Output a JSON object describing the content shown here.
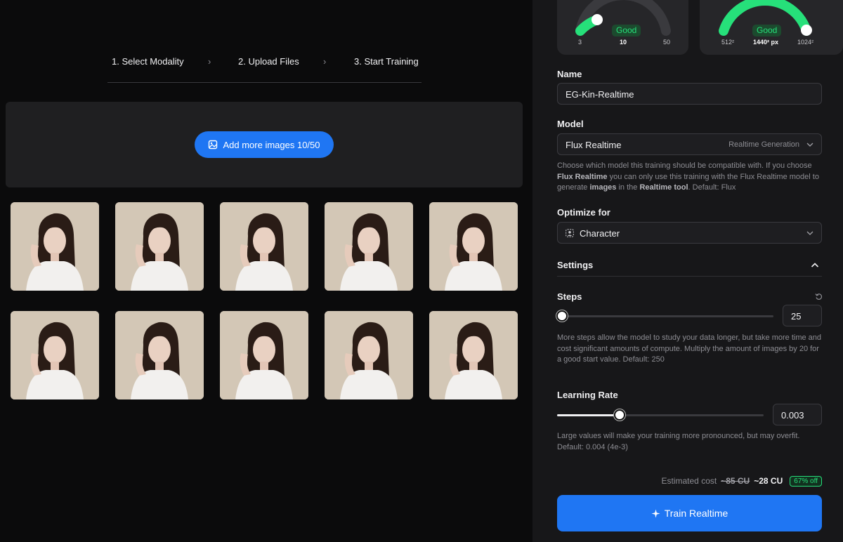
{
  "stepper": {
    "steps": [
      "1. Select Modality",
      "2. Upload Files",
      "3. Start Training"
    ],
    "chevron": "›"
  },
  "upload": {
    "add_button_label": "Add more images 10/50",
    "add_button_icon": "image-add-icon",
    "image_count": 10
  },
  "gauges": [
    {
      "status": "Good",
      "min": "3",
      "value": "10",
      "max": "50",
      "level": 0.18,
      "color": "#26e07a"
    },
    {
      "status": "Good",
      "min": "512²",
      "value": "1440² px",
      "max": "1024²",
      "level": 1.0,
      "color": "#26e07a"
    }
  ],
  "form": {
    "name": {
      "label": "Name",
      "value": "EG-Kin-Realtime"
    },
    "model": {
      "label": "Model",
      "value": "Flux Realtime",
      "tag": "Realtime Generation",
      "help_parts": [
        "Choose which model this training should be compatible with. If you choose ",
        "Flux Realtime",
        " you can only use this training with the Flux Realtime model to generate ",
        "images",
        " in the ",
        "Realtime tool",
        ". Default: Flux"
      ]
    },
    "optimize": {
      "label": "Optimize for",
      "value": "Character",
      "icon": "character-icon"
    },
    "settings": {
      "label": "Settings",
      "icon": "chevron-up-icon"
    },
    "steps": {
      "label": "Steps",
      "value": "25",
      "level": 0.0,
      "reset_icon": "reset-icon",
      "help": "More steps allow the model to study your data longer, but take more time and cost significant amounts of compute. Multiply the amount of images by 20 for a good start value. Default: 250"
    },
    "learning_rate": {
      "label": "Learning Rate",
      "value": "0.003",
      "level": 0.3,
      "help": "Large values will make your training more pronounced, but may overfit. Default: 0.004 (4e-3)"
    }
  },
  "cost": {
    "label": "Estimated cost",
    "old": "~85 CU",
    "new": "~28 CU",
    "discount": "67% off"
  },
  "train_button": {
    "label": "Train Realtime",
    "icon": "sparkle-icon"
  },
  "colors": {
    "accent": "#1f76f3",
    "good": "#26e07a",
    "panel": "#171719"
  }
}
